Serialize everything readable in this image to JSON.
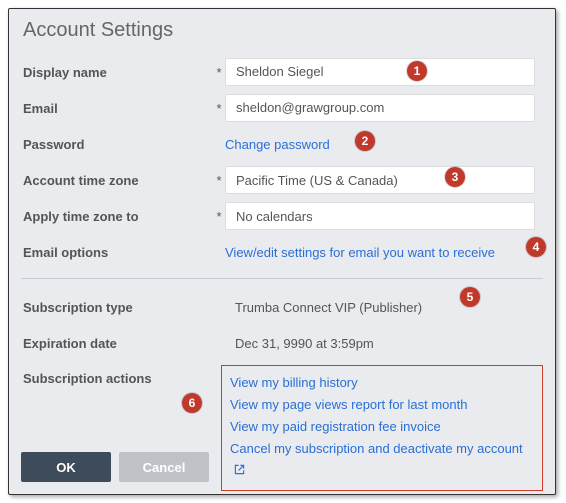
{
  "title": "Account Settings",
  "labels": {
    "display_name": "Display name",
    "email": "Email",
    "password": "Password",
    "timezone": "Account time zone",
    "apply_tz": "Apply time zone to",
    "email_opts": "Email options",
    "sub_type": "Subscription type",
    "exp_date": "Expiration date",
    "sub_actions": "Subscription actions"
  },
  "values": {
    "display_name": "Sheldon Siegel",
    "email": "sheldon@grawgroup.com",
    "timezone": "Pacific Time (US & Canada)",
    "apply_tz": "No calendars",
    "sub_type": "Trumba Connect VIP (Publisher)",
    "exp_date": "Dec 31, 9990 at 3:59pm"
  },
  "links": {
    "change_password": "Change password",
    "email_opts": "View/edit settings for email you want to receive",
    "billing": "View my billing history",
    "page_views": "View my page views report for last month",
    "invoice": "View my paid registration fee invoice",
    "cancel_sub": "Cancel my subscription and deactivate my account"
  },
  "buttons": {
    "ok": "OK",
    "cancel": "Cancel"
  },
  "badges": {
    "1": "1",
    "2": "2",
    "3": "3",
    "4": "4",
    "5": "5",
    "6": "6"
  },
  "req": "*",
  "colors": {
    "accent": "#2a6fd6",
    "badge": "#c0392b",
    "highlight_box": "#d23a2a"
  }
}
